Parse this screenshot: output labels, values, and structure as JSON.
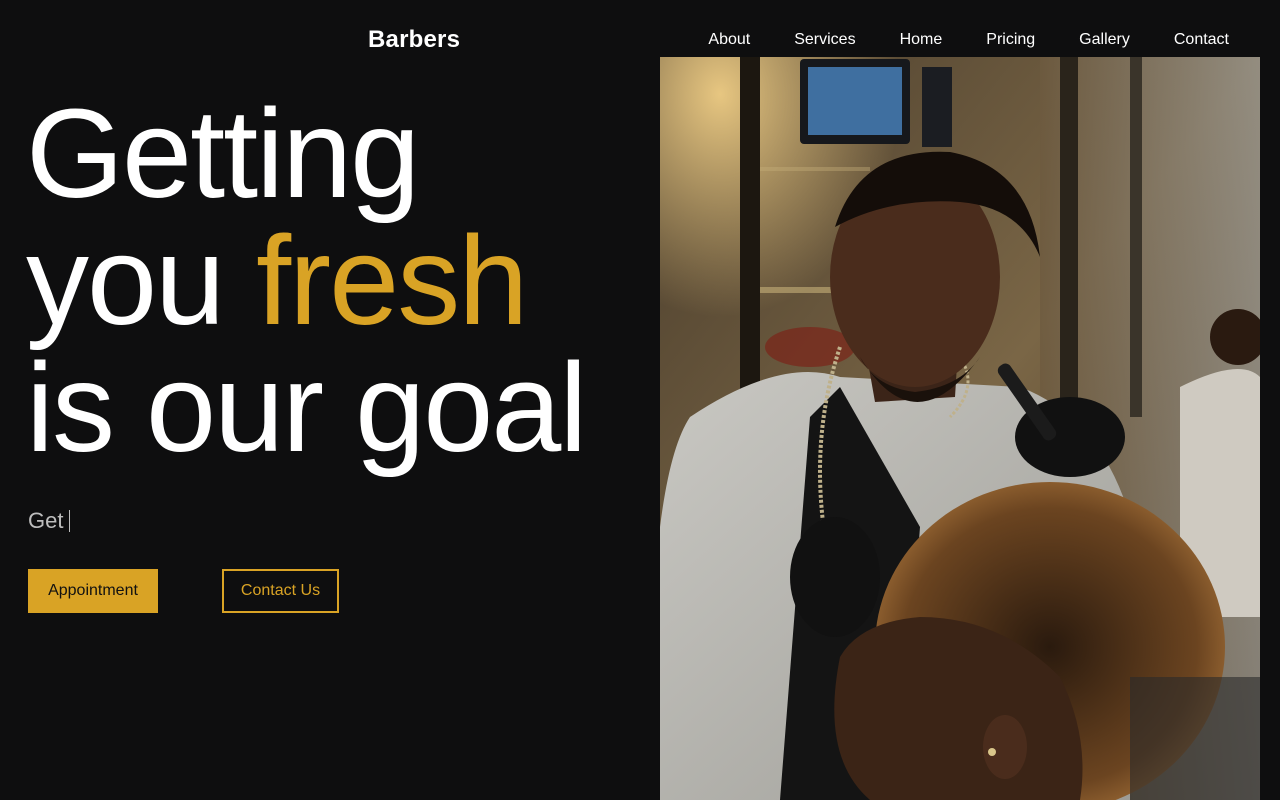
{
  "brand": {
    "name": "Barbers"
  },
  "nav": {
    "items": [
      {
        "label": "About"
      },
      {
        "label": "Services"
      },
      {
        "label": "Home"
      },
      {
        "label": "Pricing"
      },
      {
        "label": "Gallery"
      },
      {
        "label": "Contact"
      }
    ]
  },
  "hero": {
    "line1": "Getting",
    "line2_prefix": "you ",
    "line2_accent": "fresh",
    "line3": "is our goal",
    "typed_text": "Get",
    "primary_button": "Appointment",
    "secondary_button": "Contact Us"
  },
  "colors": {
    "background": "#0e0e0f",
    "accent": "#d9a325",
    "text": "#ffffff"
  },
  "photo": {
    "subject": "barber-cutting-hair-photo"
  }
}
